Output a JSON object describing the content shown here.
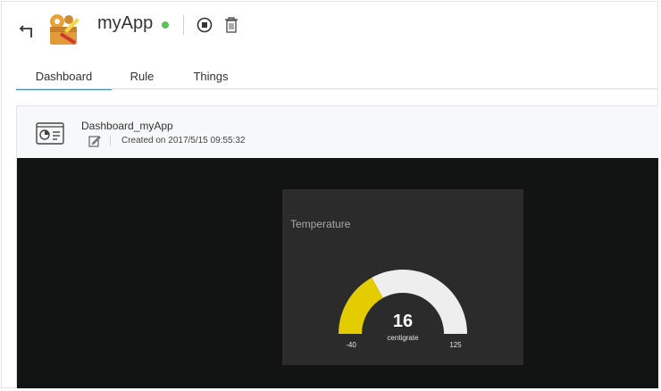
{
  "header": {
    "app_name": "myApp",
    "status": "running",
    "colors": {
      "status_dot": "#5cc35c",
      "accent": "#3f8fb3"
    },
    "icons": [
      "back-arrow-icon",
      "app-logo-icon",
      "stop-icon",
      "trash-icon"
    ]
  },
  "tabs": [
    {
      "label": "Dashboard",
      "active": true
    },
    {
      "label": "Rule",
      "active": false
    },
    {
      "label": "Things",
      "active": false
    }
  ],
  "dashboard": {
    "name": "Dashboard_myApp",
    "created": "Created on 2017/5/15 09:55:32",
    "icons": [
      "dashboard-icon",
      "edit-icon"
    ]
  },
  "widget": {
    "title": "Temperature",
    "value": "16",
    "unit": "centigrate",
    "min": "-40",
    "max": "125",
    "value_fraction": 0.339,
    "colors": {
      "fill": "#e3cc00",
      "track": "#eeeeee",
      "background": "#2b2b2b",
      "canvas": "#121313"
    }
  }
}
